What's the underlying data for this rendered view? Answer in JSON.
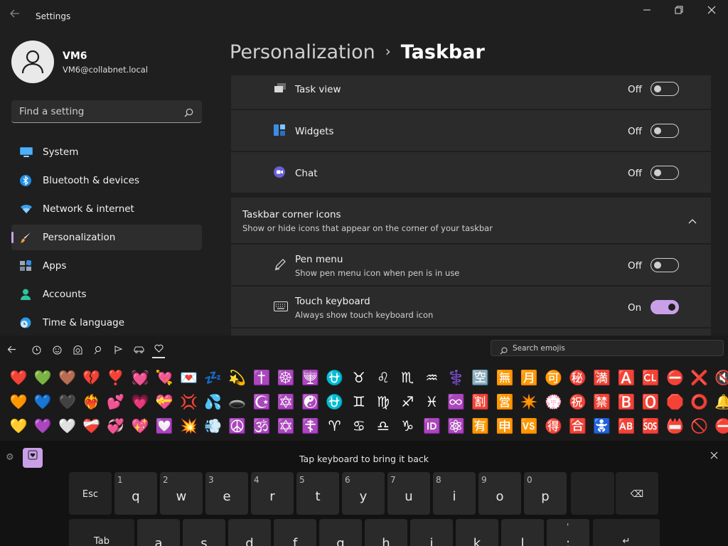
{
  "window": {
    "title": "Settings"
  },
  "user": {
    "name": "VM6",
    "email": "VM6@collabnet.local"
  },
  "search": {
    "placeholder": "Find a setting"
  },
  "nav": [
    {
      "label": "System",
      "icon": "monitor-icon"
    },
    {
      "label": "Bluetooth & devices",
      "icon": "bluetooth-icon"
    },
    {
      "label": "Network & internet",
      "icon": "wifi-icon"
    },
    {
      "label": "Personalization",
      "icon": "brush-icon",
      "active": true
    },
    {
      "label": "Apps",
      "icon": "apps-icon"
    },
    {
      "label": "Accounts",
      "icon": "person-icon"
    },
    {
      "label": "Time & language",
      "icon": "globe-clock-icon"
    }
  ],
  "header": {
    "crumb": "Personalization",
    "separator": "›",
    "page": "Taskbar"
  },
  "items": {
    "task_view": {
      "title": "Task view",
      "state": "Off"
    },
    "widgets": {
      "title": "Widgets",
      "state": "Off"
    },
    "chat": {
      "title": "Chat",
      "state": "Off"
    },
    "corner": {
      "title": "Taskbar corner icons",
      "desc": "Show or hide icons that appear on the corner of your taskbar"
    },
    "pen_menu": {
      "title": "Pen menu",
      "desc": "Show pen menu icon when pen is in use",
      "state": "Off"
    },
    "touch_keyboard": {
      "title": "Touch keyboard",
      "desc": "Always show touch keyboard icon",
      "state": "On"
    }
  },
  "emoji_panel": {
    "search_placeholder": "Search emojis",
    "tabs": [
      "back",
      "recent",
      "smileys",
      "people",
      "celebration",
      "food",
      "travel",
      "symbols"
    ],
    "rows": [
      [
        "❤️",
        "💚",
        "🤎",
        "💔",
        "❣️",
        "💓",
        "💘",
        "💌",
        "💤",
        "💫",
        "✝️",
        "☸️",
        "🕎",
        "⛎",
        "♉",
        "♌",
        "♏",
        "♒",
        "⚕️",
        "🈳",
        "🈚",
        "🈷️",
        "🉑",
        "㊙️",
        "🈵",
        "🅰️",
        "🆑",
        "⛔",
        "❌",
        "🔇"
      ],
      [
        "🧡",
        "💙",
        "🖤",
        "❤️‍🔥",
        "💕",
        "💗",
        "💝",
        "💢",
        "💦",
        "🕳️",
        "☪️",
        "🔯",
        "☯️",
        "⛎",
        "♊",
        "♍",
        "♐",
        "♓",
        "♾️",
        "🈹",
        "🈺",
        "✴️",
        "💮",
        "㊗️",
        "🈲",
        "🅱️",
        "🅾️",
        "🛑",
        "⭕",
        "🔔"
      ],
      [
        "💛",
        "💜",
        "🤍",
        "❤️‍🩹",
        "💞",
        "💖",
        "💟",
        "💥",
        "💨",
        "☮️",
        "🕉️",
        "✡️",
        "☦️",
        "♈",
        "♋",
        "♎",
        "♑",
        "🆔",
        "⚛️",
        "🈶",
        "🈸",
        "🆚",
        "🉐",
        "🈴",
        "🚼",
        "🆎",
        "🆘",
        "📛",
        "🚫",
        "⛔"
      ]
    ]
  },
  "keyboard": {
    "message": "Tap keyboard to bring it back",
    "row1": [
      {
        "lbl": "Esc"
      },
      {
        "ch": "q",
        "num": "1"
      },
      {
        "ch": "w",
        "num": "2"
      },
      {
        "ch": "e",
        "num": "3"
      },
      {
        "ch": "r",
        "num": "4"
      },
      {
        "ch": "t",
        "num": "5"
      },
      {
        "ch": "y",
        "num": "6"
      },
      {
        "ch": "u",
        "num": "7"
      },
      {
        "ch": "i",
        "num": "8"
      },
      {
        "ch": "o",
        "num": "9"
      },
      {
        "ch": "p",
        "num": "0"
      },
      {
        "lbl": ""
      },
      {
        "lbl": "⌫"
      }
    ],
    "row2": [
      {
        "lbl": "Tab"
      },
      {
        "ch": "a"
      },
      {
        "ch": "s"
      },
      {
        "ch": "d"
      },
      {
        "ch": "f"
      },
      {
        "ch": "g"
      },
      {
        "ch": "h"
      },
      {
        "ch": "j"
      },
      {
        "ch": "k"
      },
      {
        "ch": "l"
      },
      {
        "ch": ";",
        "num": "'"
      },
      {
        "lbl": "↵"
      }
    ]
  },
  "colors": {
    "accent": "#c9a0e8",
    "background": "#1f1f1f",
    "card": "#2b2b2b"
  }
}
